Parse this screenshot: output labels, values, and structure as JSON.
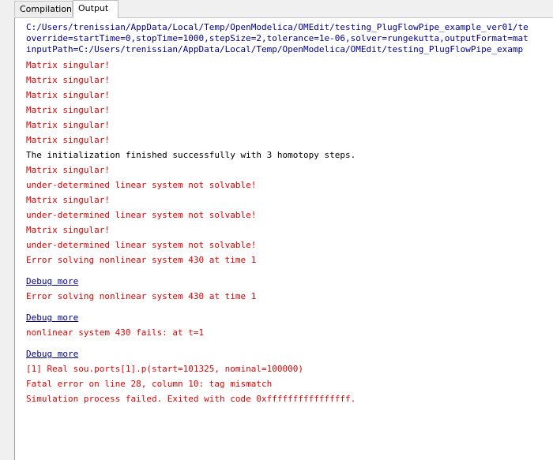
{
  "tabs": {
    "compilation": "Compilation",
    "output": "Output"
  },
  "header_lines": [
    "C:/Users/trenissian/AppData/Local/Temp/OpenModelica/OMEdit/testing_PlugFlowPipe_example_ver01/te",
    "override=startTime=0,stopTime=1000,stepSize=2,tolerance=1e-06,solver=rungekutta,outputFormat=mat",
    "inputPath=C:/Users/trenissian/AppData/Local/Temp/OpenModelica/OMEdit/testing_PlugFlowPipe_examp"
  ],
  "messages": [
    "Matrix singular!",
    "Matrix singular!",
    "Matrix singular!",
    "Matrix singular!",
    "Matrix singular!",
    "Matrix singular!",
    "The initialization finished successfully with 3 homotopy steps.",
    "Matrix singular!",
    "under-determined linear system not solvable!",
    "Matrix singular!",
    "under-determined linear system not solvable!",
    "Matrix singular!",
    "under-determined linear system not solvable!",
    "Error solving nonlinear system 430 at time 1",
    "Debug more",
    "Error solving nonlinear system 430 at time 1",
    "Debug more",
    "nonlinear system 430 fails: at t=1",
    "Debug more",
    "[1] Real sou.ports[1].p(start=101325, nominal=100000)",
    "Fatal error on line 28, column 10: tag mismatch",
    "Simulation process failed. Exited with code 0xffffffffffffffff."
  ],
  "colors": {
    "path_text": "#00008b",
    "error_text": "#e00000",
    "info_text": "#000000",
    "link_text": "#00008b"
  }
}
